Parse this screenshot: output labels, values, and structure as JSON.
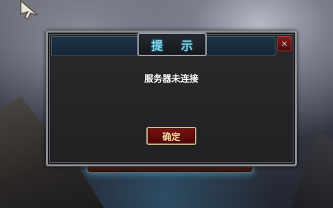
{
  "dialog": {
    "title": "提 示",
    "message": "服务器未连接",
    "confirm_label": "确定",
    "close_icon": "close-icon"
  },
  "colors": {
    "title_text": "#7ed3e8",
    "confirm_text": "#f2d9a0",
    "confirm_bg": "#7c1010",
    "close_bg": "#8a1a1a"
  }
}
